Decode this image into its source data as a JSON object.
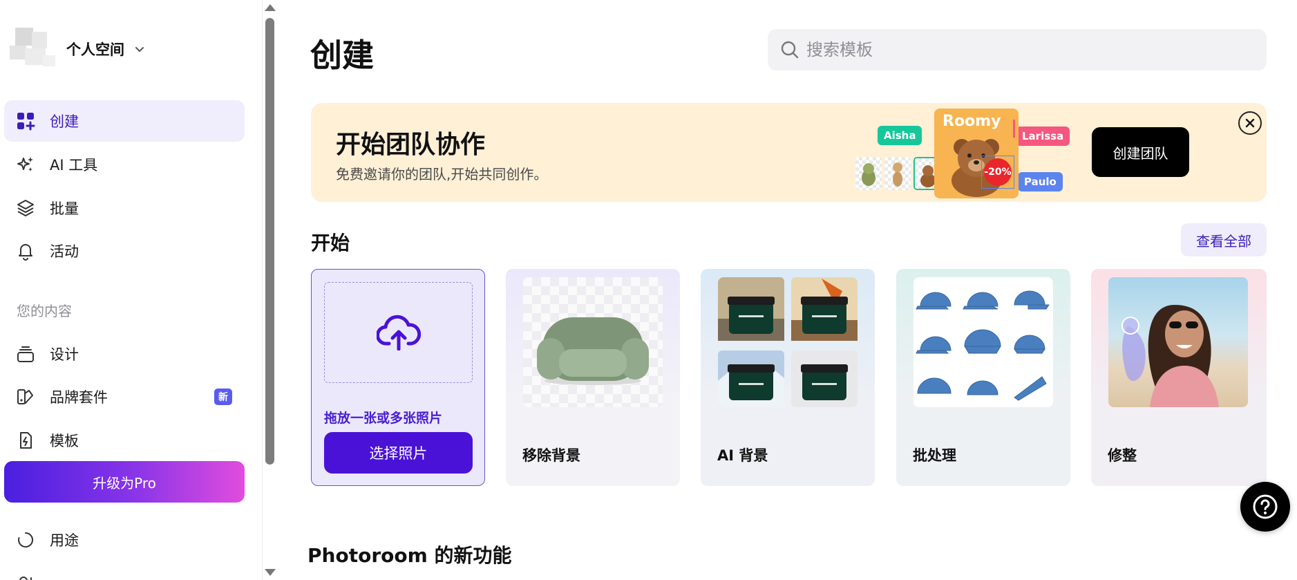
{
  "workspace": {
    "name": "个人空间"
  },
  "nav": {
    "items": [
      {
        "label": "创建",
        "icon": "grid-plus-icon"
      },
      {
        "label": "AI 工具",
        "icon": "sparkles-icon"
      },
      {
        "label": "批量",
        "icon": "layers-icon"
      },
      {
        "label": "活动",
        "icon": "bell-icon"
      }
    ],
    "content_section": "您的内容",
    "content_items": [
      {
        "label": "设计",
        "icon": "stack-icon"
      },
      {
        "label": "品牌套件",
        "icon": "brand-kit-icon",
        "badge": "新"
      },
      {
        "label": "模板",
        "icon": "template-icon"
      }
    ],
    "upgrade": "升级为Pro",
    "bottom_items": [
      {
        "label": "用途",
        "icon": "circle-arrow-icon"
      }
    ]
  },
  "header": {
    "title": "创建",
    "search_placeholder": "搜索模板"
  },
  "banner": {
    "title": "开始团队协作",
    "subtitle": "免费邀请你的团队,开始共同创作。",
    "tags": [
      "Aisha",
      "Larissa",
      "Paulo"
    ],
    "card_title": "Roomy",
    "discount": "-20%",
    "button": "创建团队"
  },
  "start": {
    "title": "开始",
    "view_all": "查看全部",
    "upload": {
      "drop_text": "拖放一张或多张照片",
      "button": "选择照片"
    },
    "cards": [
      {
        "label": "移除背景"
      },
      {
        "label": "AI 背景"
      },
      {
        "label": "批处理"
      },
      {
        "label": "修整"
      }
    ]
  },
  "news": {
    "title": "Photoroom 的新功能"
  },
  "colors": {
    "accent": "#4a12d6",
    "active_bg": "#f0edfc",
    "banner_bg": "#fff0d6"
  }
}
